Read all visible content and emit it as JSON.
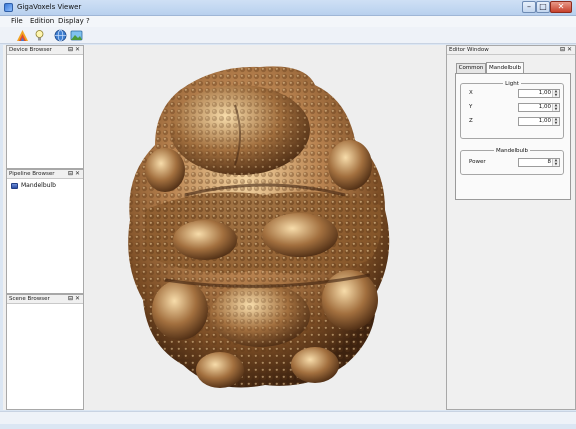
{
  "window": {
    "title": "GigaVoxels Viewer",
    "min": "–",
    "max": "□",
    "close": "✕"
  },
  "menu": {
    "items": [
      "File",
      "Edition",
      "Display",
      "?"
    ]
  },
  "toolbar": {
    "icons": [
      "color-palette-icon",
      "light-bulb-icon",
      "globe-icon",
      "scene-landscape-icon"
    ]
  },
  "docks": {
    "device_browser": {
      "title": "Device Browser",
      "float": "⊟",
      "close": "✕"
    },
    "pipeline_browser": {
      "title": "Pipeline Browser",
      "float": "⊟",
      "close": "✕",
      "items": [
        "Mandelbulb"
      ]
    },
    "scene_browser": {
      "title": "Scene Browser",
      "float": "⊟",
      "close": "✕"
    }
  },
  "editor": {
    "title": "Editor Window",
    "float": "⊟",
    "close": "✕",
    "tabs": [
      "Common",
      "Mandelbulb"
    ],
    "active_tab": "Mandelbulb",
    "light_group": {
      "title": "Light",
      "fields": [
        {
          "label": "X",
          "value": "1,00"
        },
        {
          "label": "Y",
          "value": "1,00"
        },
        {
          "label": "Z",
          "value": "1,00"
        }
      ]
    },
    "mandelbulb_group": {
      "title": "Mandelbulb",
      "fields": [
        {
          "label": "Power",
          "value": "8"
        }
      ]
    }
  },
  "colors": {
    "fractal_base": "#9c6a3a",
    "fractal_highlight": "#f3d3a0",
    "fractal_shadow": "#3d220f"
  }
}
